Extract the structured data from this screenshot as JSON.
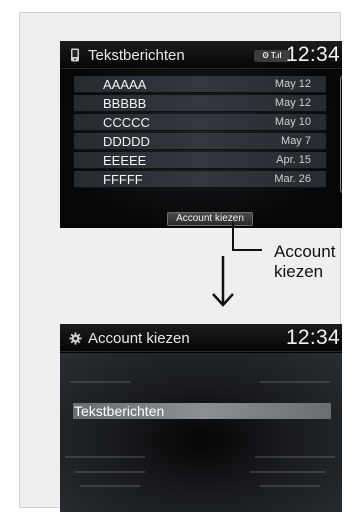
{
  "screen1": {
    "title": "Tekstberichten",
    "title_icon": "phone-icon",
    "status_badge": "ʘ T.ıl",
    "clock": "12:34",
    "messages": [
      {
        "name": "AAAAA",
        "date": "May 12"
      },
      {
        "name": "BBBBB",
        "date": "May 12"
      },
      {
        "name": "CCCCC",
        "date": "May 10"
      },
      {
        "name": "DDDDD",
        "date": "May  7"
      },
      {
        "name": "EEEEE",
        "date": "Apr. 15"
      },
      {
        "name": "FFFFF",
        "date": "Mar. 26"
      }
    ],
    "account_button": "Account kiezen",
    "scroll_up_icon": "chevron-double-up-icon",
    "scroll_down_icon": "chevron-double-down-icon"
  },
  "callout": {
    "line1": "Account",
    "line2": "kiezen"
  },
  "screen2": {
    "title": "Account kiezen",
    "title_icon": "gear-icon",
    "clock": "12:34",
    "menu_item": "Tekstberichten"
  },
  "colors": {
    "screen_bg": "#000000",
    "list_item": "#32383e",
    "selected_item": "#8d9093",
    "text": "#f4f4f4"
  }
}
